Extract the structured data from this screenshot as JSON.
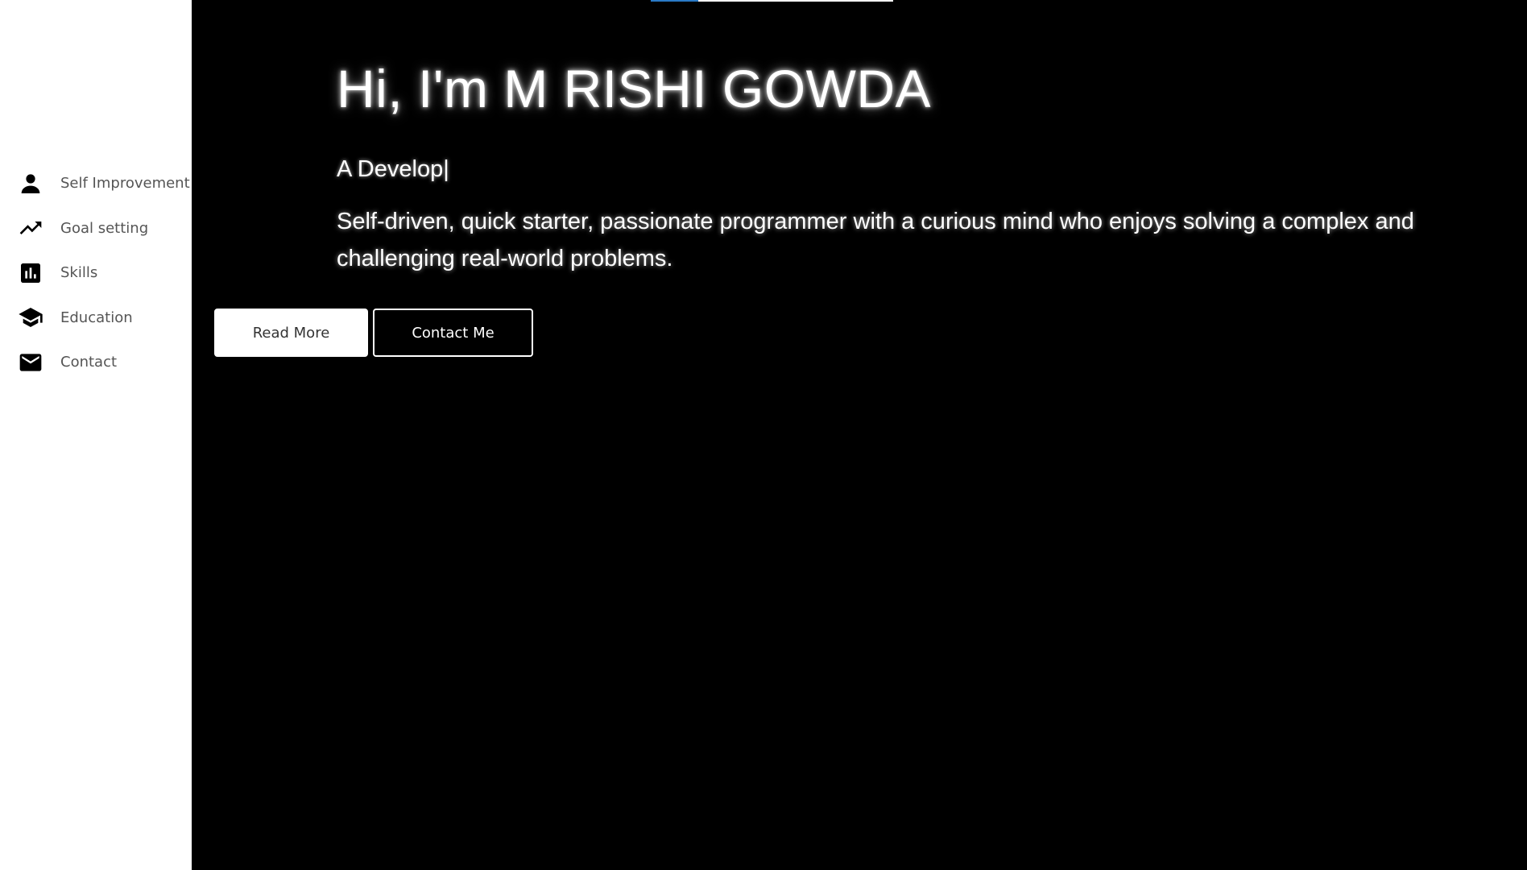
{
  "sidebar": {
    "items": [
      {
        "label": "Self Improvement",
        "icon": "person-icon"
      },
      {
        "label": "Goal setting",
        "icon": "trending-up-icon"
      },
      {
        "label": "Skills",
        "icon": "bar-chart-icon"
      },
      {
        "label": "Education",
        "icon": "graduation-cap-icon"
      },
      {
        "label": "Contact",
        "icon": "mail-icon"
      }
    ]
  },
  "hero": {
    "title": "Hi, I'm M RISHI GOWDA",
    "typing_text": "A Develop|",
    "description": "Self-driven, quick starter, passionate programmer with a curious mind who enjoys solving a complex and challenging real-world problems.",
    "read_more_label": "Read More",
    "contact_label": "Contact Me"
  },
  "scroll_progress": 0.195,
  "colors": {
    "sidebar_bg": "#ffffff",
    "main_bg": "#000000",
    "accent": "#2a7ac6",
    "nav_text": "#555555"
  }
}
